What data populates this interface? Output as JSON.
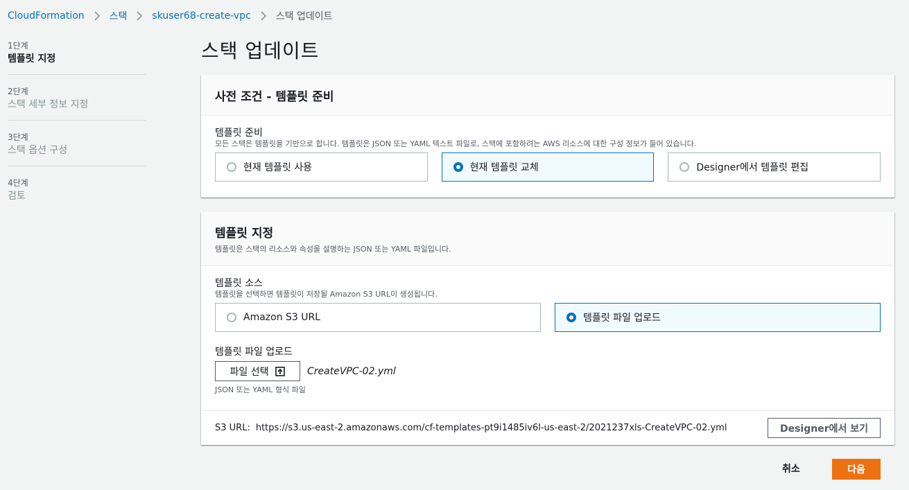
{
  "breadcrumb": {
    "items": [
      "CloudFormation",
      "스택",
      "skuser68-create-vpc"
    ],
    "current": "스택 업데이트"
  },
  "steps": [
    {
      "num": "1단계",
      "title": "템플릿 지정",
      "active": true
    },
    {
      "num": "2단계",
      "title": "스택 세부 정보 지정",
      "active": false
    },
    {
      "num": "3단계",
      "title": "스택 옵션 구성",
      "active": false
    },
    {
      "num": "4단계",
      "title": "검토",
      "active": false
    }
  ],
  "page_title": "스택 업데이트",
  "prereq": {
    "header": "사전 조건 - 템플릿 준비",
    "field_label": "템플릿 준비",
    "field_desc": "모든 스택은 템플릿을 기반으로 합니다. 템플릿은 JSON 또는 YAML 텍스트 파일로, 스택에 포함하려는 AWS 리소스에 대한 구성 정보가 들어 있습니다.",
    "options": [
      "현재 템플릿 사용",
      "현재 템플릿 교체",
      "Designer에서 템플릿 편집"
    ],
    "selected": "현재 템플릿 교체"
  },
  "template": {
    "header": "템플릿 지정",
    "header_desc": "템플릿은 스택의 리소스와 속성을 설명하는 JSON 또는 YAML 파일입니다.",
    "source_label": "템플릿 소스",
    "source_desc": "템플릿을 선택하면 템플릿이 저장될 Amazon S3 URL이 생성됩니다.",
    "source_options": [
      "Amazon S3 URL",
      "템플릿 파일 업로드"
    ],
    "source_selected": "템플릿 파일 업로드",
    "upload_label": "템플릿 파일 업로드",
    "choose_file_button": "파일 선택",
    "file_name": "CreateVPC-02.yml",
    "upload_hint": "JSON 또는 YAML 형식 파일",
    "s3_label": "S3 URL:",
    "s3_url": "https://s3.us-east-2.amazonaws.com/cf-templates-pt9i1485iv6l-us-east-2/2021237xls-CreateVPC-02.yml",
    "designer_button": "Designer에서 보기"
  },
  "footer": {
    "cancel": "취소",
    "next": "다음"
  },
  "colors": {
    "link": "#0073bb",
    "primary_button": "#ec7211",
    "selected_tile_border": "#0073bb",
    "selected_tile_bg": "#f1faff",
    "page_bg": "#f2f3f3"
  },
  "icons": [
    "chevron-right-icon",
    "upload-icon",
    "radio-icon"
  ]
}
